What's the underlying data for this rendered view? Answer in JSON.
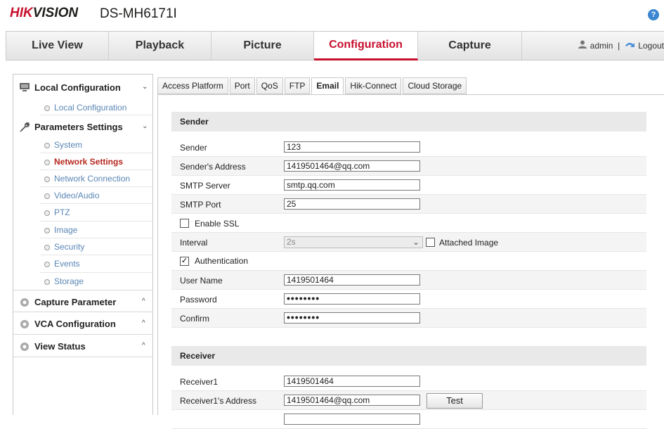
{
  "brand": {
    "logo_a": "HIK",
    "logo_b": "VISION",
    "model": "DS-MH6171I",
    "help": "?"
  },
  "nav": {
    "tabs": [
      {
        "label": "Live View"
      },
      {
        "label": "Playback"
      },
      {
        "label": "Picture"
      },
      {
        "label": "Configuration",
        "active": true
      },
      {
        "label": "Capture"
      }
    ],
    "user": "admin",
    "separator": "|",
    "logout": "Logout"
  },
  "sidebar": {
    "local": {
      "title": "Local Configuration",
      "chevron": "⌄",
      "items": [
        "Local Configuration"
      ]
    },
    "params": {
      "title": "Parameters Settings",
      "chevron": "⌄",
      "items": [
        "System",
        "Network Settings",
        "Network Connection",
        "Video/Audio",
        "PTZ",
        "Image",
        "Security",
        "Events",
        "Storage"
      ],
      "active": "Network Settings"
    },
    "capture": {
      "title": "Capture Parameter",
      "chevron": "^"
    },
    "vca": {
      "title": "VCA Configuration",
      "chevron": "^"
    },
    "status": {
      "title": "View Status",
      "chevron": "^"
    }
  },
  "subtabs": [
    "Access Platform",
    "Port",
    "QoS",
    "FTP",
    "Email",
    "Hik-Connect",
    "Cloud Storage"
  ],
  "active_subtab": "Email",
  "sender": {
    "header": "Sender",
    "sender_label": "Sender",
    "sender_value": "123",
    "address_label": "Sender's Address",
    "address_value": "1419501464@qq.com",
    "smtp_server_label": "SMTP Server",
    "smtp_server_value": "smtp.qq.com",
    "smtp_port_label": "SMTP Port",
    "smtp_port_value": "25",
    "ssl_label": "Enable SSL",
    "ssl_checked": false,
    "interval_label": "Interval",
    "interval_value": "2s",
    "attached_label": "Attached Image",
    "attached_checked": false,
    "auth_label": "Authentication",
    "auth_checked": true,
    "username_label": "User Name",
    "username_value": "1419501464",
    "password_label": "Password",
    "password_value": "••••••••",
    "confirm_label": "Confirm",
    "confirm_value": "••••••••"
  },
  "receiver": {
    "header": "Receiver",
    "r1_label": "Receiver1",
    "r1_value": "1419501464",
    "r1_addr_label": "Receiver1's Address",
    "r1_addr_value": "1419501464@qq.com",
    "test_label": "Test"
  },
  "colors": {
    "accent": "#c8102e",
    "link": "#5a86b5",
    "active_item": "#b5261d"
  }
}
